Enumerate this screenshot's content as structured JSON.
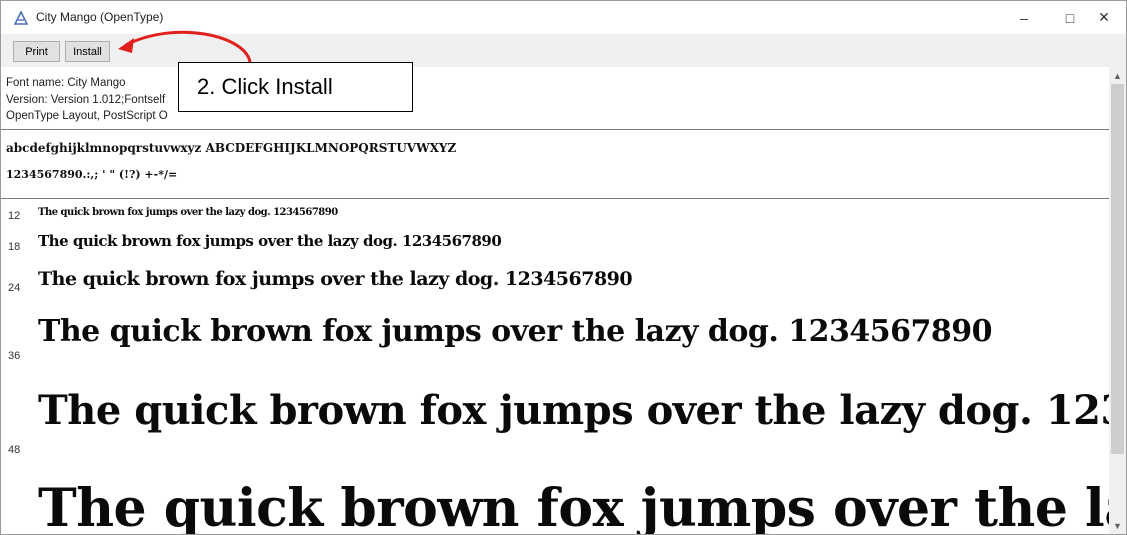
{
  "window": {
    "title": "City Mango (OpenType)",
    "controls": {
      "minimize": "–",
      "maximize": "□",
      "close": "✕"
    }
  },
  "toolbar": {
    "print_label": "Print",
    "install_label": "Install"
  },
  "font_info": {
    "name_line": "Font name: City Mango",
    "version_line": "Version: Version 1.012;Fontself",
    "layout_line": "OpenType Layout, PostScript O"
  },
  "charset": {
    "letters": "abcdefghijklmnopqrstuvwxyz ABCDEFGHIJKLMNOPQRSTUVWXYZ",
    "digits": "1234567890.:,; ' \" (!?) +-*/="
  },
  "samples": [
    {
      "size": "12",
      "text": "The quick brown fox jumps over the lazy dog. 1234567890"
    },
    {
      "size": "18",
      "text": "The quick brown fox jumps over the lazy dog. 1234567890"
    },
    {
      "size": "24",
      "text": "The quick brown fox jumps over the lazy dog. 1234567890"
    },
    {
      "size": "36",
      "text": "The quick brown fox jumps over the lazy dog. 1234567890"
    },
    {
      "size": "48",
      "text": "The quick brown fox jumps over the lazy dog. 123"
    },
    {
      "size": "",
      "text": "The quick brown fox jumps over the laz"
    }
  ],
  "annotation": {
    "callout_text": "2. Click Install",
    "arrow_color": "#e0201c"
  },
  "scrollbar": {
    "up_arrow": "▲",
    "down_arrow": "▼"
  },
  "colors": {
    "toolbar_bg": "#f0f0f0",
    "accent": "#e0201c"
  }
}
